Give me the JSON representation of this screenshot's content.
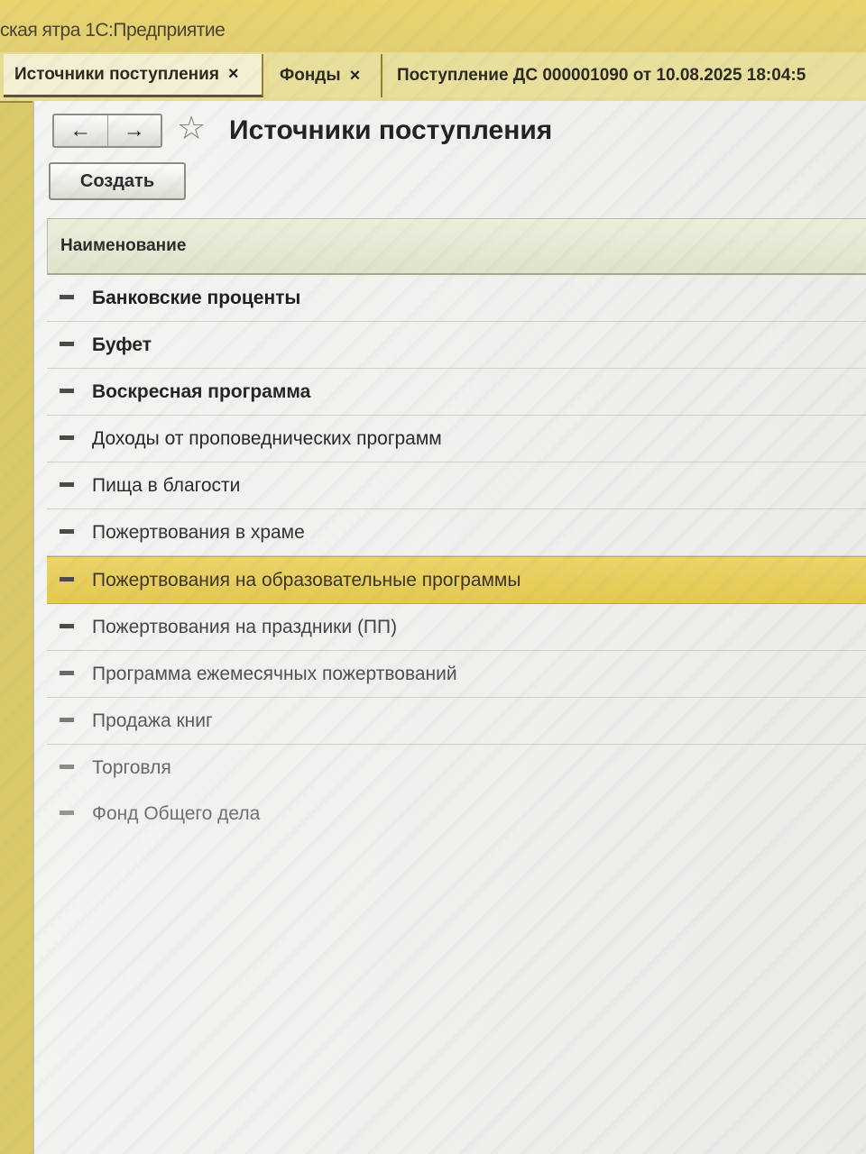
{
  "app": {
    "title": "ская ятра 1С:Предприятие"
  },
  "tabs": [
    {
      "label": "Источники поступления",
      "close": "×"
    },
    {
      "label": "Фонды",
      "close": "×"
    },
    {
      "label": "Поступление ДС 000001090 от 10.08.2025 18:04:5"
    }
  ],
  "toolbar": {
    "back_icon": "←",
    "forward_icon": "→",
    "favorite_icon": "☆",
    "page_title": "Источники поступления",
    "create_label": "Создать"
  },
  "table": {
    "column_header": "Наименование",
    "rows": [
      {
        "label": "Банковские проценты",
        "selected": false
      },
      {
        "label": "Буфет",
        "selected": false
      },
      {
        "label": "Воскресная программа",
        "selected": false
      },
      {
        "label": "Доходы от проповеднических программ",
        "selected": false
      },
      {
        "label": "Пища в благости",
        "selected": false
      },
      {
        "label": "Пожертвования в храме",
        "selected": false
      },
      {
        "label": "Пожертвования на образовательные программы",
        "selected": true
      },
      {
        "label": "Пожертвования на праздники (ПП)",
        "selected": false
      },
      {
        "label": "Программа ежемесячных пожертвований",
        "selected": false
      },
      {
        "label": "Продажа книг",
        "selected": false
      },
      {
        "label": "Торговля",
        "selected": false
      },
      {
        "label": "Фонд Общего дела",
        "selected": false
      }
    ]
  },
  "colors": {
    "selection": "#e3c94f",
    "header_bg": "#dfe3cb",
    "window_bg": "#eef0ec",
    "titlebar_bg": "#e2cf74"
  }
}
